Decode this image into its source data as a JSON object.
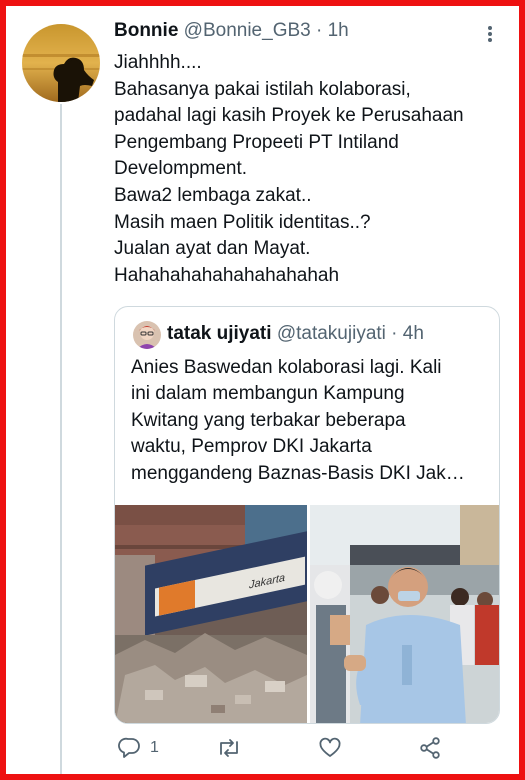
{
  "tweet": {
    "author_name": "Bonnie",
    "author_handle": "@Bonnie_GB3",
    "separator": "·",
    "time": "1h",
    "lines": [
      "Jiahhhh....",
      "Bahasanya pakai istilah kolaborasi,",
      "padahal lagi kasih Proyek ke Perusahaan",
      "Pengembang Propeeti PT Intiland",
      "Develompment.",
      "Bawa2 lembaga zakat..",
      "Masih maen Politik identitas..?",
      "Jualan ayat dan Mayat.",
      "Hahahahahahahahahahah"
    ]
  },
  "quoted": {
    "author_name": "tatak ujiyati",
    "author_handle": "@tatakujiyati",
    "separator": "·",
    "time": "4h",
    "lines": [
      "Anies Baswedan kolaborasi lagi. Kali",
      "ini dalam membangun Kampung",
      "Kwitang yang terbakar beberapa",
      "waktu, Pemprov DKI Jakarta",
      "menggandeng Baznas-Basis DKI Jak…"
    ],
    "banner_text": "Jakarta"
  },
  "actions": {
    "reply_count": "1",
    "retweet_count": "",
    "like_count": ""
  },
  "colors": {
    "border": "#ee1111",
    "text": "#0f1419",
    "muted": "#536471",
    "divider": "#cfd9de"
  }
}
